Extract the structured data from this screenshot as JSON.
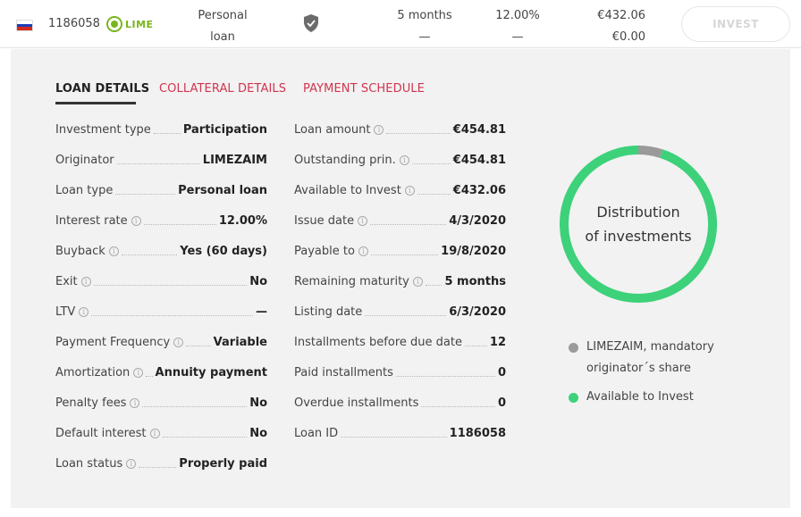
{
  "top": {
    "loan_id": "1186058",
    "originator_logo": "LIME",
    "loan_type_line1": "Personal",
    "loan_type_line2": "loan",
    "term": "5 months",
    "term_sub": "—",
    "rate": "12.00%",
    "rate_sub": "—",
    "available": "€432.06",
    "invested": "€0.00",
    "invest_label": "INVEST",
    "country_flag": "russia-flag-icon",
    "buyback_icon": "shield-check-icon"
  },
  "tabs": [
    "LOAN DETAILS",
    "COLLATERAL DETAILS",
    "PAYMENT SCHEDULE"
  ],
  "left": [
    {
      "label": "Investment type",
      "info": false,
      "value": "Participation"
    },
    {
      "label": "Originator",
      "info": false,
      "value": "LIMEZAIM"
    },
    {
      "label": "Loan type",
      "info": false,
      "value": "Personal loan"
    },
    {
      "label": "Interest rate",
      "info": true,
      "value": "12.00%"
    },
    {
      "label": "Buyback",
      "info": true,
      "value": "Yes (60 days)"
    },
    {
      "label": "Exit",
      "info": true,
      "value": "No"
    },
    {
      "label": "LTV",
      "info": true,
      "value": "—"
    },
    {
      "label": "Payment Frequency",
      "info": true,
      "value": "Variable"
    },
    {
      "label": "Amortization",
      "info": true,
      "value": "Annuity payment"
    },
    {
      "label": "Penalty fees",
      "info": true,
      "value": "No"
    },
    {
      "label": "Default interest",
      "info": true,
      "value": "No"
    },
    {
      "label": "Loan status",
      "info": true,
      "value": "Properly paid"
    }
  ],
  "right": [
    {
      "label": "Loan amount",
      "info": true,
      "value": "€454.81"
    },
    {
      "label": "Outstanding prin.",
      "info": true,
      "value": "€454.81"
    },
    {
      "label": "Available to Invest",
      "info": true,
      "value": "€432.06"
    },
    {
      "label": "Issue date",
      "info": true,
      "value": "4/3/2020"
    },
    {
      "label": "Payable to",
      "info": true,
      "value": "19/8/2020"
    },
    {
      "label": "Remaining maturity",
      "info": true,
      "value": "5 months"
    },
    {
      "label": "Listing date",
      "info": false,
      "value": "6/3/2020"
    },
    {
      "label": "Installments before due date",
      "info": false,
      "value": "12"
    },
    {
      "label": "Paid installments",
      "info": false,
      "value": "0"
    },
    {
      "label": "Overdue installments",
      "info": false,
      "value": "0"
    },
    {
      "label": "Loan ID",
      "info": false,
      "value": "1186058"
    }
  ],
  "distribution": {
    "title_line1": "Distribution",
    "title_line2": "of investments",
    "colors": {
      "mandatory": "#9a9a9a",
      "available": "#3dd17a"
    },
    "segments": [
      {
        "name": "LIMEZAIM, mandatory originator´s share",
        "value": 22.75
      },
      {
        "name": "Available to Invest",
        "value": 432.06
      }
    ],
    "legend_line1": "LIMEZAIM, mandatory",
    "legend_line2": "originator´s share",
    "legend_available": "Available to Invest"
  }
}
